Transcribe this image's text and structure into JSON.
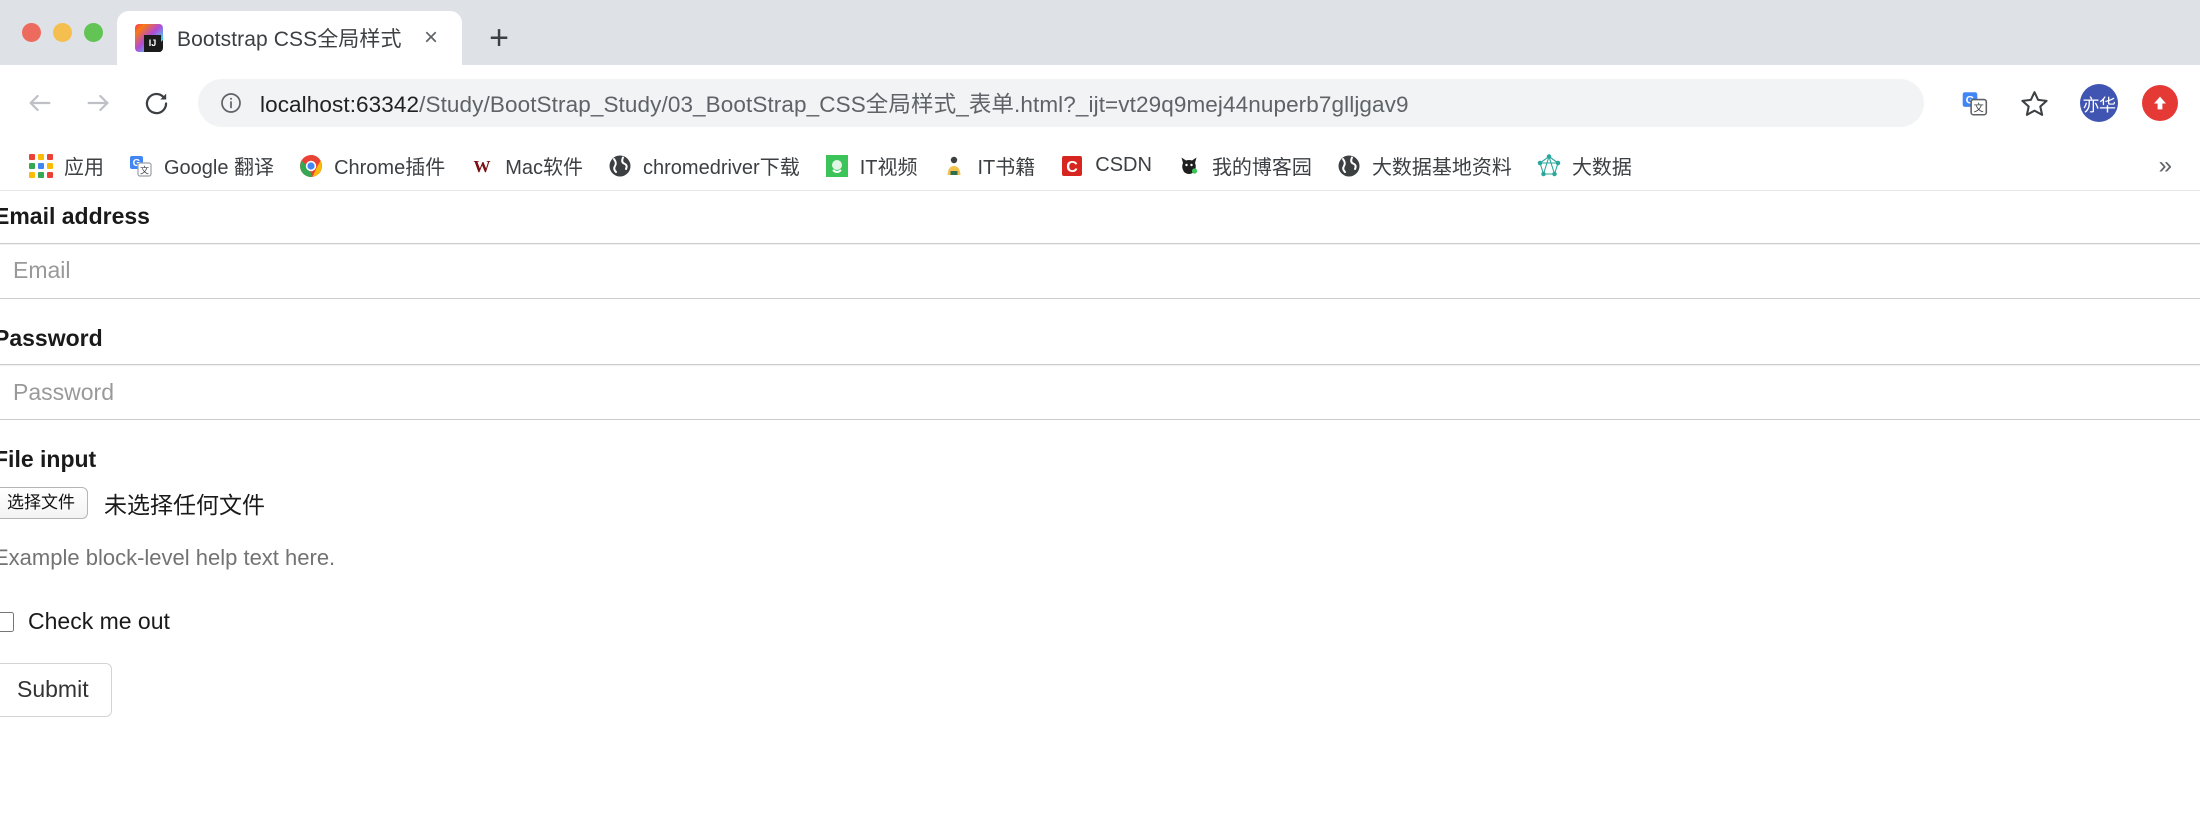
{
  "window": {
    "traffic_lights": [
      {
        "name": "close",
        "color": "#ed6a5e"
      },
      {
        "name": "minimize",
        "color": "#f5bf4f"
      },
      {
        "name": "maximize",
        "color": "#61c454"
      }
    ]
  },
  "tabs": [
    {
      "title": "Bootstrap CSS全局样式",
      "favicon": "intellij-idea-icon",
      "close_label": "×"
    }
  ],
  "new_tab_label": "+",
  "toolbar": {
    "back_icon": "arrow-left-icon",
    "forward_icon": "arrow-right-icon",
    "reload_icon": "reload-icon",
    "site_info_icon": "info-circle-icon",
    "url_host": "localhost:63342",
    "url_path": "/Study/BootStrap_Study/03_BootStrap_CSS全局样式_表单.html?_ijt=vt29q9mej44nuperb7glljgav9",
    "url_full": "localhost:63342/Study/BootStrap_Study/03_BootStrap_CSS全局样式_表单.html?_ijt=vt29q9mej44nuperb7glljgav9",
    "translate_icon": "google-translate-icon",
    "bookmark_star_icon": "star-icon",
    "avatar_label": "亦华",
    "avatar_color": "#4054b2",
    "update_icon": "update-arrow-icon",
    "update_color": "#e53935"
  },
  "bookmarks": {
    "items": [
      {
        "label": "应用",
        "icon": "apps-grid-icon"
      },
      {
        "label": "Google 翻译",
        "icon": "google-translate-icon"
      },
      {
        "label": "Chrome插件",
        "icon": "chrome-icon"
      },
      {
        "label": "Mac软件",
        "icon": "w-letter-icon"
      },
      {
        "label": "chromedriver下载",
        "icon": "globe-icon"
      },
      {
        "label": "IT视频",
        "icon": "green-square-icon"
      },
      {
        "label": "IT书籍",
        "icon": "person-icon"
      },
      {
        "label": "CSDN",
        "icon": "csdn-icon"
      },
      {
        "label": "我的博客园",
        "icon": "cat-icon"
      },
      {
        "label": "大数据基地资料",
        "icon": "globe-icon"
      },
      {
        "label": "大数据",
        "icon": "network-graph-icon"
      }
    ],
    "overflow_label": "»"
  },
  "page": {
    "form": {
      "email": {
        "label": "Email address",
        "placeholder": "Email",
        "value": ""
      },
      "password": {
        "label": "Password",
        "placeholder": "Password",
        "value": ""
      },
      "file": {
        "label": "File input",
        "button_label": "选择文件",
        "status_text": "未选择任何文件",
        "help_text": "Example block-level help text here."
      },
      "checkbox": {
        "label": "Check me out",
        "checked": false
      },
      "submit": {
        "label": "Submit"
      }
    }
  }
}
